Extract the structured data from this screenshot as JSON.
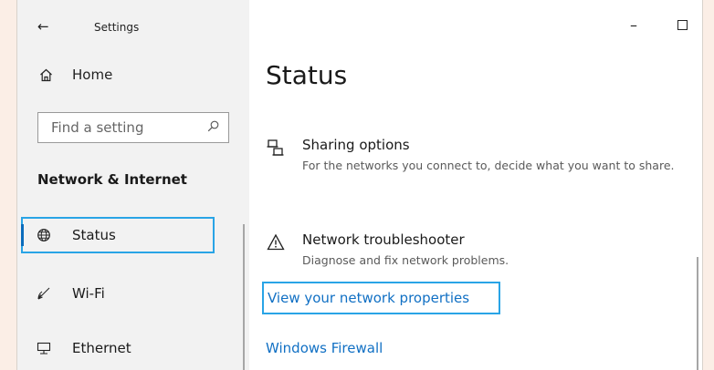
{
  "titlebar": {
    "back_glyph": "←",
    "title": "Settings",
    "minimize_glyph": "–"
  },
  "sidebar": {
    "home_label": "Home",
    "home_icon": "home-icon",
    "search_placeholder": "Find a setting",
    "search_icon": "search-icon",
    "group_heading": "Network & Internet",
    "items": [
      {
        "label": "Status",
        "icon": "globe-status-icon",
        "selected": true
      },
      {
        "label": "Wi-Fi",
        "icon": "wifi-icon",
        "selected": false
      },
      {
        "label": "Ethernet",
        "icon": "ethernet-icon",
        "selected": false
      }
    ]
  },
  "main": {
    "title": "Status",
    "options": [
      {
        "title": "Sharing options",
        "description": "For the networks you connect to, decide what you want to share.",
        "icon": "sharing-icon"
      },
      {
        "title": "Network troubleshooter",
        "description": "Diagnose and fix network problems.",
        "icon": "warning-icon"
      }
    ],
    "links": [
      {
        "label": "View your network properties",
        "highlighted": true
      },
      {
        "label": "Windows Firewall",
        "highlighted": false
      }
    ]
  },
  "colors": {
    "accent": "#1170c4",
    "highlight_border": "#29a4e6",
    "sidebar_bg": "#f2f2f2",
    "outer_bg": "#fbeee6"
  }
}
